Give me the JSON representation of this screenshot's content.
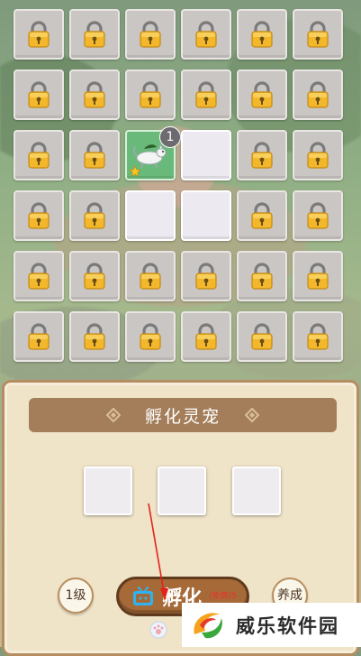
{
  "grid": {
    "rows": [
      [
        "locked",
        "locked",
        "locked",
        "locked",
        "locked",
        "locked"
      ],
      [
        "locked",
        "locked",
        "locked",
        "locked",
        "locked",
        "locked"
      ],
      [
        "locked",
        "locked",
        "pet",
        "empty",
        "locked",
        "locked"
      ],
      [
        "locked",
        "locked",
        "empty",
        "empty",
        "locked",
        "locked"
      ],
      [
        "locked",
        "locked",
        "locked",
        "locked",
        "locked",
        "locked"
      ],
      [
        "locked",
        "locked",
        "locked",
        "locked",
        "locked",
        "locked"
      ]
    ],
    "pet": {
      "level": "1",
      "icon": "white-wolf-pet-icon"
    }
  },
  "panel": {
    "title": "孵化灵宠",
    "egg_slots": 3,
    "level_button": "1级",
    "hatch_button": "孵化",
    "hatch_free_note": "(免费)5",
    "train_button": "养成"
  },
  "watermark": {
    "text": "威乐软件园"
  },
  "colors": {
    "slot_locked": "#c9c6c4",
    "slot_pet": "#69ba7a",
    "panel_bg": "#efe3c8",
    "title_bar": "#a47e5a",
    "hatch_button": "#a66a38",
    "lock_gold": "#f2b72b"
  }
}
